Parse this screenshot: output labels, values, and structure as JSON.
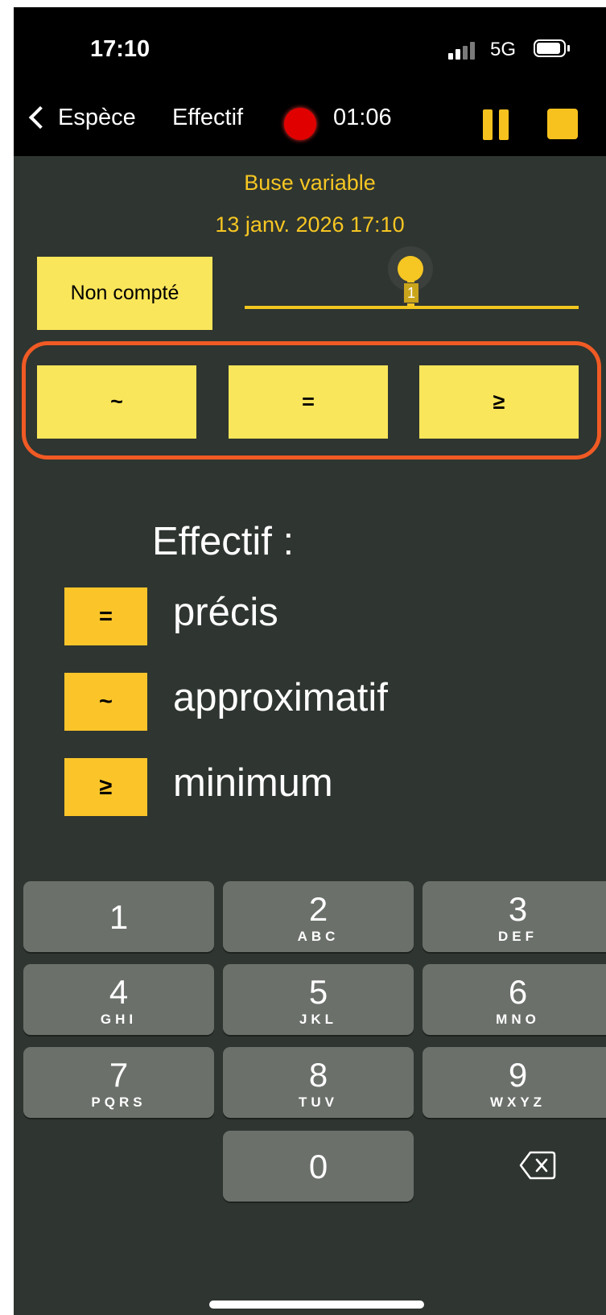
{
  "status_bar": {
    "time": "17:10",
    "network": "5G"
  },
  "nav": {
    "back_label": "Espèce",
    "title": "Effectif",
    "timer": "01:06"
  },
  "observation": {
    "species": "Buse variable",
    "date": "13 janv. 2026 17:10"
  },
  "not_counted_label": "Non compté",
  "slider": {
    "value": "1"
  },
  "modes": [
    {
      "symbol": "~"
    },
    {
      "symbol": "="
    },
    {
      "symbol": "≥"
    }
  ],
  "legend": {
    "title": "Effectif :",
    "items": [
      {
        "symbol": "=",
        "label": "précis"
      },
      {
        "symbol": "~",
        "label": "approximatif"
      },
      {
        "symbol": "≥",
        "label": "minimum"
      }
    ]
  },
  "keypad": [
    {
      "digit": "1",
      "letters": ""
    },
    {
      "digit": "2",
      "letters": "ABC"
    },
    {
      "digit": "3",
      "letters": "DEF"
    },
    {
      "digit": "4",
      "letters": "GHI"
    },
    {
      "digit": "5",
      "letters": "JKL"
    },
    {
      "digit": "6",
      "letters": "MNO"
    },
    {
      "digit": "7",
      "letters": "PQRS"
    },
    {
      "digit": "8",
      "letters": "TUV"
    },
    {
      "digit": "9",
      "letters": "WXYZ"
    },
    {
      "digit": "0",
      "letters": ""
    }
  ],
  "colors": {
    "accent_yellow": "#f6c623",
    "button_yellow": "#fae65a",
    "highlight_orange": "#f15a24",
    "record_red": "#e10000",
    "background": "#2f3530"
  }
}
